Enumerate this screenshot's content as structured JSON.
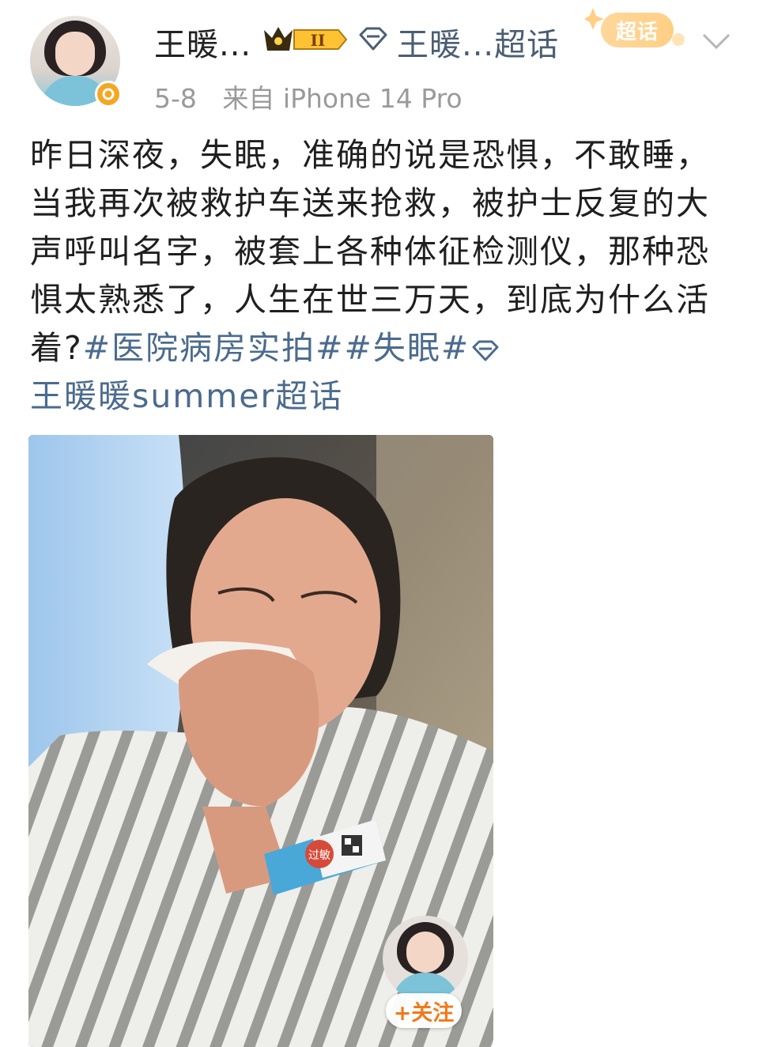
{
  "header": {
    "name": "王暖...",
    "level": "II",
    "chaohua_link": "王暖...超话",
    "chaohua_tag": "超话",
    "date": "5-8",
    "source": "来自 iPhone 14 Pro"
  },
  "post": {
    "text": "昨日深夜，失眠，准确的说是恐惧，不敢睡，当我再次被救护车送来抢救，被护士反复的大声呼叫名字，被套上各种体征检测仪，那种恐惧太熟悉了，人生在世三万天，到底为什么活着?",
    "hashtag_1": "#医院病房实拍#",
    "hashtag_2": "#失眠#",
    "chaohua_name": "王暖暖summer超话"
  },
  "photo": {
    "wristband_text": "过敏",
    "follow_label": "+关注"
  },
  "colors": {
    "link": "#4b6b8e",
    "badge_gold": "#f5a623",
    "follow_orange": "#f07a1a"
  }
}
